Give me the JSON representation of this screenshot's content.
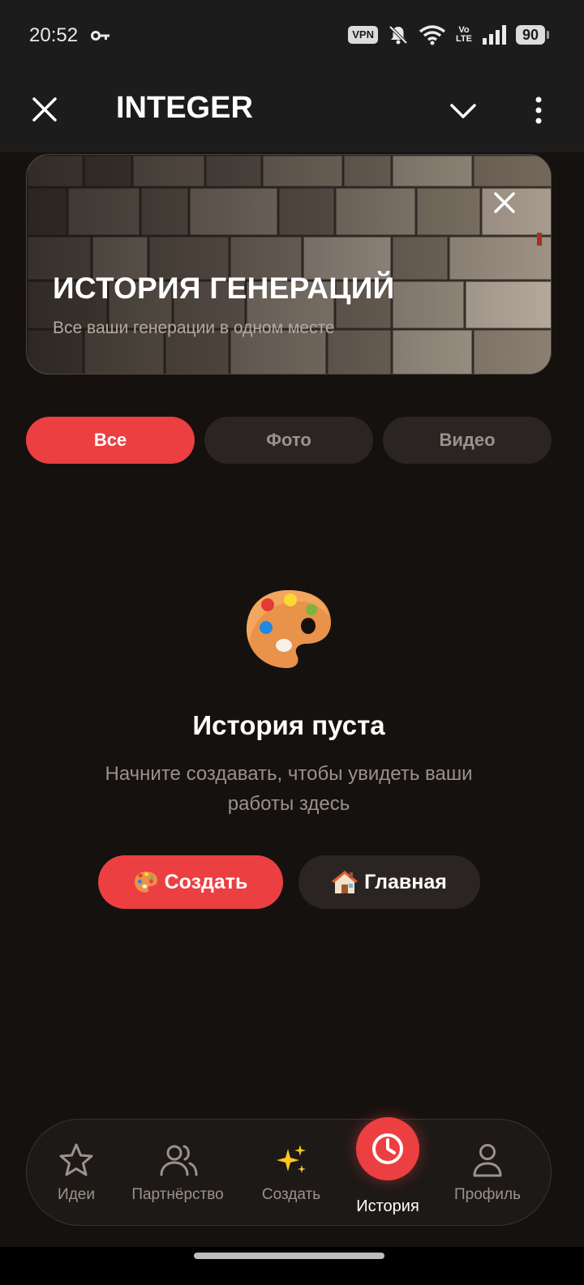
{
  "status": {
    "time": "20:52",
    "vpn": "VPN",
    "volte_top": "Vo",
    "volte_bottom": "LTE",
    "battery": "90"
  },
  "appbar": {
    "title": "INTEGER",
    "close_icon": "close-icon",
    "chevron_icon": "chevron-down-icon",
    "more_icon": "more-vertical-icon"
  },
  "banner": {
    "title": "ИСТОРИЯ ГЕНЕРАЦИЙ",
    "subtitle": "Все ваши генерации в одном месте"
  },
  "tabs": [
    {
      "label": "Все",
      "active": true
    },
    {
      "label": "Фото",
      "active": false
    },
    {
      "label": "Видео",
      "active": false
    }
  ],
  "empty": {
    "title": "История пуста",
    "text": "Начните создавать, чтобы увидеть ваши работы здесь",
    "create_label": "Создать",
    "home_label": "Главная"
  },
  "nav": {
    "ideas": "Идеи",
    "partnership": "Партнёрство",
    "create": "Создать",
    "history": "История",
    "profile": "Профиль"
  },
  "colors": {
    "accent": "#ec3f41",
    "background": "#15110f",
    "surface": "#2a2522"
  }
}
